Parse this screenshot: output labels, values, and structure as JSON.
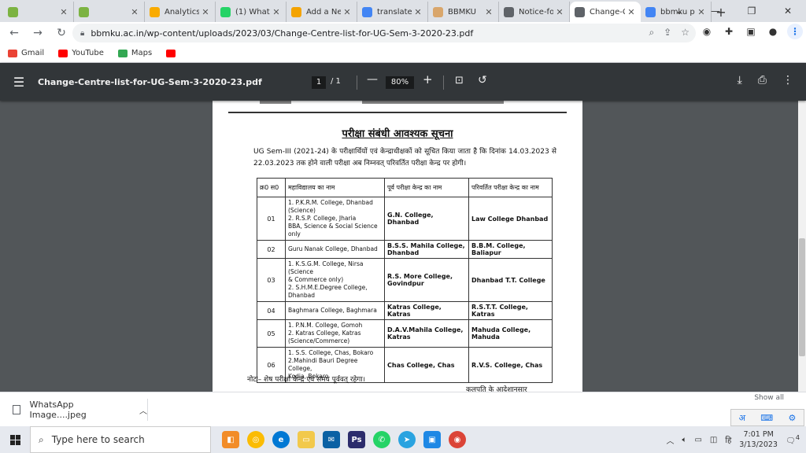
{
  "browser": {
    "tabs": [
      {
        "label": "",
        "icon_color": "#7cb342"
      },
      {
        "label": "",
        "icon_color": "#7cb342"
      },
      {
        "label": "Analytics",
        "icon_color": "#f9ab00"
      },
      {
        "label": "(1) What",
        "icon_color": "#25d366"
      },
      {
        "label": "Add a Ne",
        "icon_color": "#f4a300"
      },
      {
        "label": "translate",
        "icon_color": "#4285f4"
      },
      {
        "label": "BBMKU",
        "icon_color": "#d9a66b"
      },
      {
        "label": "Notice-fo",
        "icon_color": "#5f6368"
      },
      {
        "label": "Change-C",
        "icon_color": "#5f6368",
        "active": true
      },
      {
        "label": "bbmku p",
        "icon_color": "#4285f4"
      }
    ],
    "new_tab": "+",
    "tab_search": "⌄",
    "window_controls": {
      "minimize": "—",
      "restore": "❐",
      "close": "✕"
    },
    "url": "bbmku.ac.in/wp-content/uploads/2023/03/Change-Centre-list-for-UG-Sem-3-2020-23.pdf",
    "bookmarks": [
      {
        "label": "Gmail",
        "color": "#ea4335"
      },
      {
        "label": "YouTube",
        "color": "#ff0000"
      },
      {
        "label": "Maps",
        "color": "#34a853"
      },
      {
        "label": "",
        "color": "#ff0000"
      }
    ]
  },
  "pdf_viewer": {
    "title": "Change-Centre-list-for-UG-Sem-3-2020-23.pdf",
    "page_current": "1",
    "page_total": "/ 1",
    "zoom": "80%"
  },
  "document": {
    "heading": "परीक्षा संबंधी आवश्यक सूचना",
    "paragraph": "UG Sem-III (2021-24) के परीक्षार्थियों एवं केन्द्राधीक्षकों को सूचित किया जाता है कि दिनांक 14.03.2023 से 22.03.2023 तक होने वाली परीक्षा अब निम्नवत् परिवर्तित परीक्षा केन्द्र पर होगी।",
    "table": {
      "headers": [
        "क्र0 स0",
        "महाविद्यालय का नाम",
        "पूर्व परीक्षा केन्द्र का नाम",
        "परिवर्तित परीक्षा केन्द्र का नाम"
      ],
      "rows": [
        {
          "sn": "01",
          "colleges": [
            "1.  P.K.R.M. College, Dhanbad",
            "(Science)",
            "2.  R.S.P. College, Jharia",
            "BBA, Science & Social Science",
            "only"
          ],
          "previous": "G.N. College, Dhanbad",
          "new": "Law College Dhanbad"
        },
        {
          "sn": "02",
          "colleges": [
            "Guru Nanak College, Dhanbad"
          ],
          "previous": "B.S.S. Mahila College, Dhanbad",
          "new": "B.B.M. College, Baliapur"
        },
        {
          "sn": "03",
          "colleges": [
            "1. K.S.G.M. College, Nirsa (Science",
            "& Commerce only)",
            "2. S.H.M.E.Degree College,",
            "Dhanbad"
          ],
          "previous": "R.S. More College, Govindpur",
          "new": "Dhanbad T.T. College"
        },
        {
          "sn": "04",
          "colleges": [
            "Baghmara College, Baghmara"
          ],
          "previous": "Katras College, Katras",
          "new": "R.S.T.T. College, Katras"
        },
        {
          "sn": "05",
          "colleges": [
            "1. P.N.M. College, Gomoh",
            "2. Katras College, Katras",
            "(Science/Commerce)"
          ],
          "previous": "D.A.V.Mahila College, Katras",
          "new": "Mahuda College, Mahuda"
        },
        {
          "sn": "06",
          "colleges": [
            "1. S.S. College, Chas, Bokaro",
            "2.Mahindi Bauri Degree College,",
            "Kodia, Bokaro"
          ],
          "previous": "Chas College, Chas",
          "new": "R.V.S. College, Chas"
        }
      ]
    },
    "note": "नोटः– शेष परीक्षा केन्द्र एवं समय पूर्ववत् रहेगा।",
    "signature": "कुलपति के आदेशानुसार"
  },
  "downloads": {
    "file": "WhatsApp Image....jpeg",
    "show_all": "Show all"
  },
  "taskbar": {
    "search_placeholder": "Type here to search",
    "time": "7:01 PM",
    "date": "3/13/2023",
    "notifications": "4",
    "ime_text": "अ"
  }
}
